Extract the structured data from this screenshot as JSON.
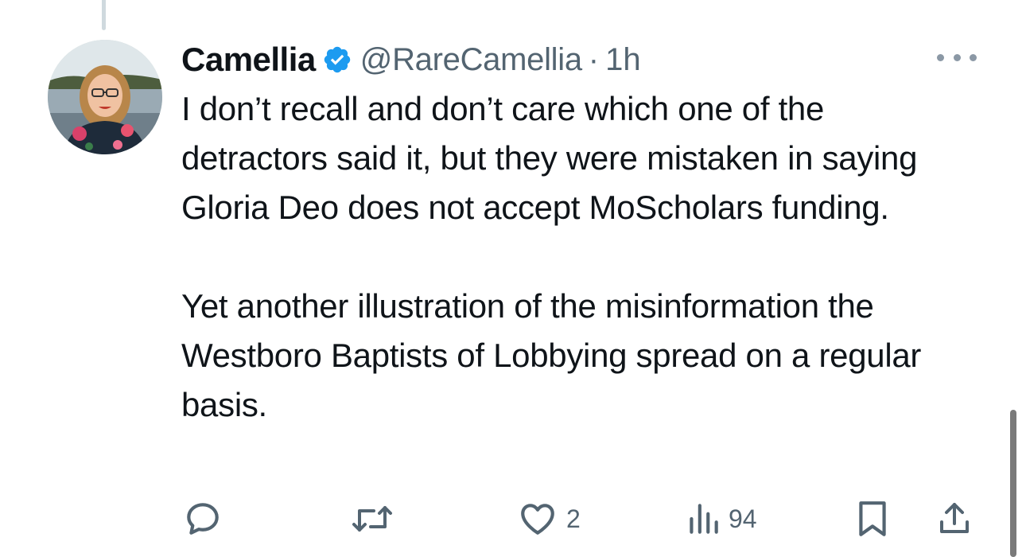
{
  "tweet": {
    "author": {
      "display_name": "Camellia",
      "handle": "@RareCamellia",
      "verified": true
    },
    "separator": "·",
    "timestamp": "1h",
    "paragraphs": [
      "I don’t recall and don’t care which one of the detractors said it, but they were mistaken in saying Gloria Deo does not accept MoScholars funding.",
      "Yet another illustration of the misinformation the Westboro Baptists of Lobbying spread on a regular basis."
    ],
    "metrics": {
      "replies": "",
      "retweets": "",
      "likes": "2",
      "views": "94"
    }
  },
  "icons": {
    "verified": "verified-badge-icon",
    "more": "more-options-icon",
    "reply": "reply-icon",
    "retweet": "retweet-icon",
    "like": "heart-icon",
    "views": "views-chart-icon",
    "bookmark": "bookmark-icon",
    "share": "share-icon"
  },
  "colors": {
    "accent": "#1d9bf0",
    "text": "#0f1419",
    "secondary": "#536471"
  }
}
